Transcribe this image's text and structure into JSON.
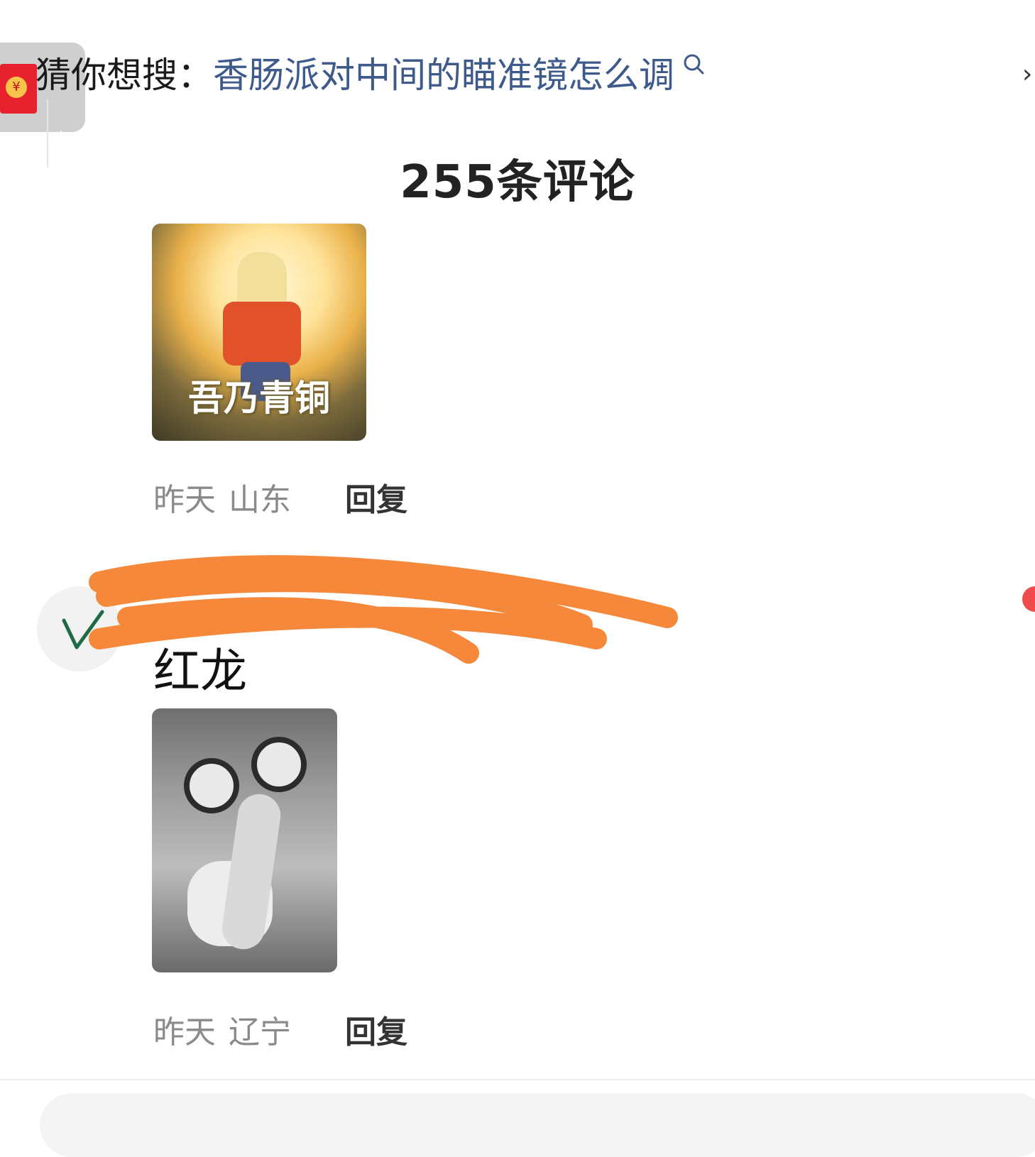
{
  "search_suggestion": {
    "label": "猜你想搜：",
    "query": "香肠派对中间的瞄准镜怎么调",
    "icon": "search-icon"
  },
  "red_packet": {
    "coin_glyph": "¥",
    "icon": "red-envelope-icon"
  },
  "comments_header": {
    "count_text": "255条评论"
  },
  "comments": [
    {
      "sticker_caption": "吾乃青铜",
      "time": "昨天",
      "location": "山东",
      "reply_label": "回复"
    },
    {
      "nickname": "红龙",
      "time": "昨天",
      "location": "辽宁",
      "reply_label": "回复"
    }
  ],
  "colors": {
    "query_link": "#3d5a8a",
    "red_envelope": "#e8212e",
    "scribble": "#f5883a",
    "check_mark": "#1f6b45",
    "meta_text": "#8a8a8a"
  }
}
